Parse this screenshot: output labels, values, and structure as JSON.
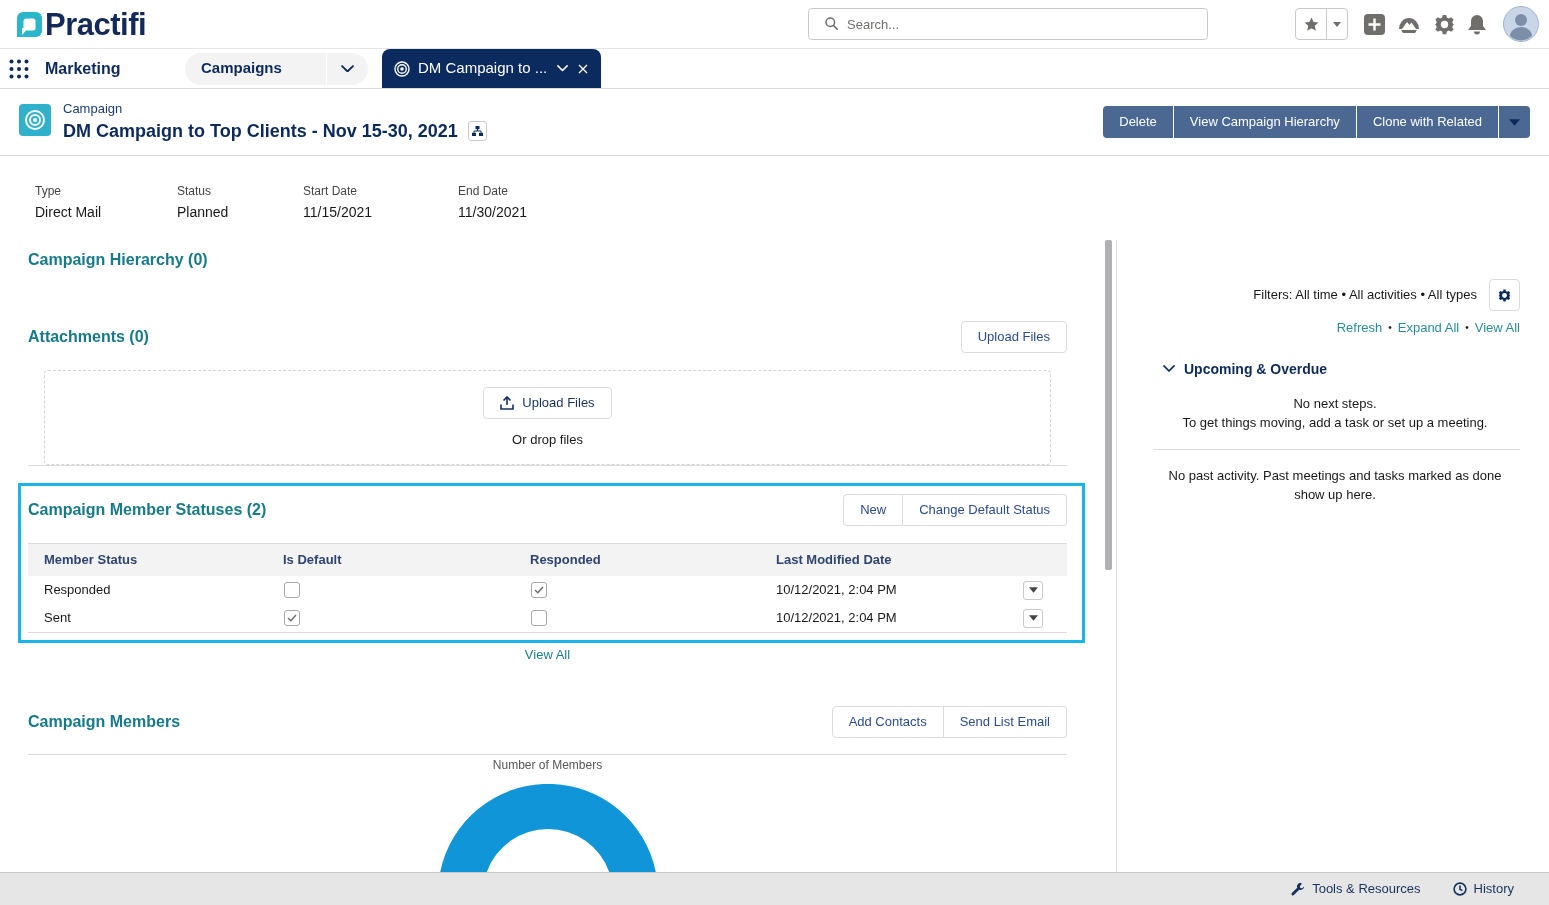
{
  "header": {
    "logo": "Practifi",
    "search": {
      "placeholder": "Search..."
    }
  },
  "nav": {
    "app_name": "Marketing",
    "tabs": [
      {
        "label": "Campaigns",
        "selected": false,
        "kind": "object"
      },
      {
        "label": "DM Campaign to ...",
        "selected": true,
        "kind": "record"
      }
    ]
  },
  "record": {
    "object_label": "Campaign",
    "title": "DM Campaign to Top Clients - Nov 15-30, 2021",
    "actions": [
      "Delete",
      "View Campaign Hierarchy",
      "Clone with Related"
    ]
  },
  "fields": [
    {
      "label": "Type",
      "value": "Direct Mail"
    },
    {
      "label": "Status",
      "value": "Planned"
    },
    {
      "label": "Start Date",
      "value": "11/15/2021"
    },
    {
      "label": "End Date",
      "value": "11/30/2021"
    }
  ],
  "campaign_hierarchy": {
    "title": "Campaign Hierarchy (0)"
  },
  "attachments": {
    "title": "Attachments (0)",
    "button": "Upload Files",
    "dropzone": {
      "button": "Upload Files",
      "hint": "Or drop files"
    }
  },
  "member_statuses": {
    "title": "Campaign Member Statuses (2)",
    "highlighted": true,
    "buttons": [
      "New",
      "Change Default Status"
    ],
    "columns": [
      "Member Status",
      "Is Default",
      "Responded",
      "Last Modified Date"
    ],
    "rows": [
      {
        "member_status": "Responded",
        "is_default": false,
        "responded": true,
        "last_modified": "10/12/2021, 2:04 PM"
      },
      {
        "member_status": "Sent",
        "is_default": true,
        "responded": false,
        "last_modified": "10/12/2021, 2:04 PM"
      }
    ],
    "view_all": "View All"
  },
  "campaign_members": {
    "title": "Campaign Members",
    "buttons": [
      "Add Contacts",
      "Send List Email"
    ],
    "chart_title": "Number of Members"
  },
  "activity": {
    "filters": "Filters: All time • All activities • All types",
    "links": [
      {
        "kind": "link",
        "label": "Refresh"
      },
      {
        "kind": "separator",
        "label": "•"
      },
      {
        "kind": "link",
        "label": "Expand All"
      },
      {
        "kind": "separator",
        "label": "•"
      },
      {
        "kind": "link",
        "label": "View All"
      }
    ],
    "upcoming": {
      "title": "Upcoming & Overdue",
      "expanded": true,
      "empty_lines": [
        "No next steps.",
        "To get things moving, add a task or set up a meeting."
      ]
    },
    "past": "No past activity. Past meetings and tasks marked as done show up here."
  },
  "footer": [
    {
      "kind": "tools",
      "label": "Tools & Resources"
    },
    {
      "kind": "history",
      "label": "History"
    }
  ]
}
